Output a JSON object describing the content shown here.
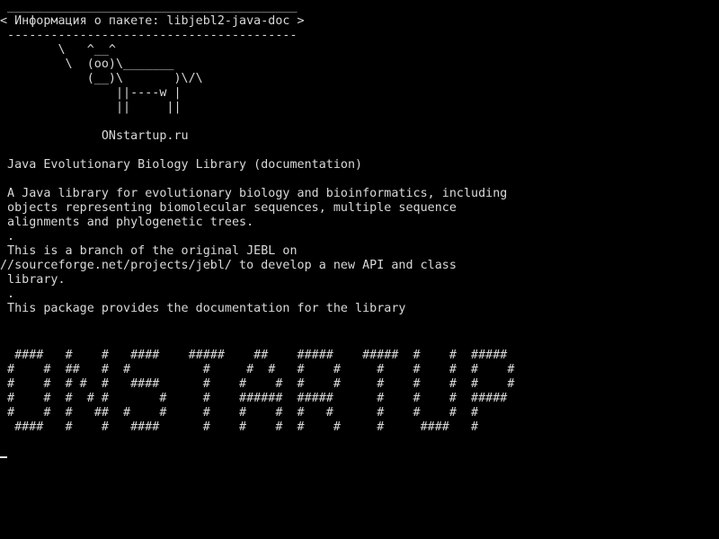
{
  "terminal": {
    "colors": {
      "background": "#000000",
      "foreground": "#d9d9d9"
    },
    "lines": [
      " ________________________________________",
      "< Информация о пакете: libjebl2-java-doc >",
      " ----------------------------------------",
      "        \\   ^__^",
      "         \\  (oo)\\_______",
      "            (__)\\       )\\/\\",
      "                ||----w |",
      "                ||     ||",
      "",
      "              ONstartup.ru",
      "",
      " Java Evolutionary Biology Library (documentation)",
      "",
      " A Java library for evolutionary biology and bioinformatics, including",
      " objects representing biomolecular sequences, multiple sequence",
      " alignments and phylogenetic trees.",
      " .",
      " This is a branch of the original JEBL on",
      "//sourceforge.net/projects/jebl/ to develop a new API and class",
      " library.",
      " .",
      " This package provides the documentation for the library",
      "",
      "",
      "  ####   #    #   ####    #####    ##    #####    #####  #    #  #####",
      " #    #  ##   #  #          #     #  #   #    #     #    #    #  #    #",
      " #    #  # #  #   ####      #    #    #  #    #     #    #    #  #    #",
      " #    #  #  # #       #     #    ######  #####      #    #    #  #####",
      " #    #  #   ##  #    #     #    #    #  #   #      #    #    #  #",
      "  ####   #    #   ####      #    #    #  #    #     #     ####   #"
    ]
  }
}
